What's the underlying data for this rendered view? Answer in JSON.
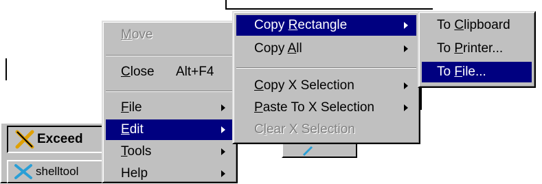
{
  "taskbar": {
    "exceed_label": "Exceed",
    "shelltool_label": "shelltool"
  },
  "system_menu": {
    "items": [
      {
        "pre": "",
        "ul": "M",
        "post": "ove",
        "accel": "",
        "disabled": true
      },
      {
        "pre": "",
        "ul": "C",
        "post": "lose",
        "accel": "Alt+F4",
        "disabled": false
      },
      {
        "pre": "",
        "ul": "F",
        "post": "ile",
        "accel": "",
        "disabled": false
      },
      {
        "pre": "",
        "ul": "E",
        "post": "dit",
        "accel": "",
        "disabled": false
      },
      {
        "pre": "",
        "ul": "T",
        "post": "ools",
        "accel": "",
        "disabled": false
      },
      {
        "pre": "",
        "ul": "",
        "post": "Help",
        "accel": "",
        "disabled": false
      }
    ]
  },
  "edit_menu": {
    "items": [
      {
        "pre": "Copy ",
        "ul": "R",
        "post": "ectangle"
      },
      {
        "pre": "Copy ",
        "ul": "A",
        "post": "ll"
      },
      {
        "pre": "",
        "ul": "C",
        "post": "opy X Selection"
      },
      {
        "pre": "",
        "ul": "P",
        "post": "aste To X Selection"
      },
      {
        "pre": "C",
        "ul": "l",
        "post": "ear X Selection"
      }
    ]
  },
  "copy_rect_menu": {
    "items": [
      {
        "pre": "To ",
        "ul": "C",
        "post": "lipboard"
      },
      {
        "pre": "To ",
        "ul": "P",
        "post": "rinter..."
      },
      {
        "pre": "To ",
        "ul": "F",
        "post": "ile..."
      }
    ]
  },
  "colors": {
    "highlight": "#000080",
    "menu_face": "#c0c0c0",
    "disabled_text": "#808080"
  },
  "icons": {
    "exceed": "exceed-x-icon",
    "shelltool": "shelltool-x-icon",
    "submenu": "submenu-arrow-icon"
  }
}
